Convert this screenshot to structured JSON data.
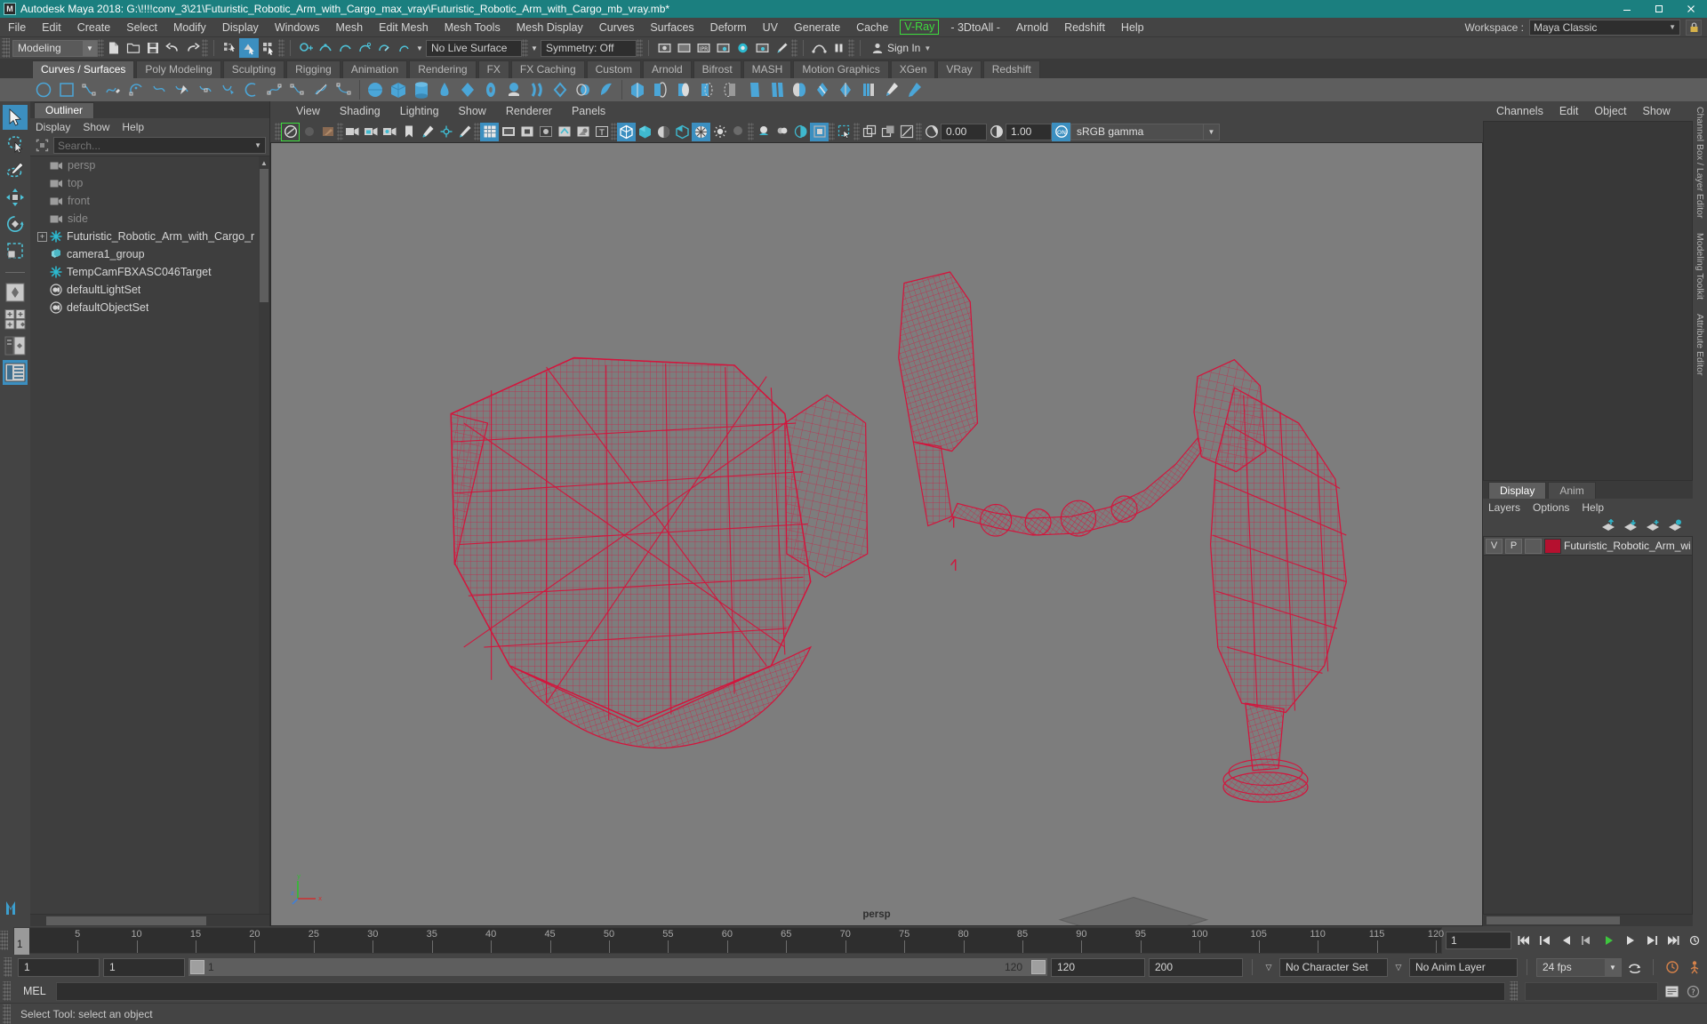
{
  "window": {
    "title": "Autodesk Maya 2018: G:\\!!!!conv_3\\21\\Futuristic_Robotic_Arm_with_Cargo_max_vray\\Futuristic_Robotic_Arm_with_Cargo_mb_vray.mb*",
    "logo_letter": "M",
    "minimize_label": "Minimize",
    "maximize_label": "Restore",
    "close_label": "Close"
  },
  "menubar": {
    "items": [
      {
        "label": "File"
      },
      {
        "label": "Edit"
      },
      {
        "label": "Create"
      },
      {
        "label": "Select"
      },
      {
        "label": "Modify"
      },
      {
        "label": "Display"
      },
      {
        "label": "Windows"
      },
      {
        "label": "Mesh"
      },
      {
        "label": "Edit Mesh"
      },
      {
        "label": "Mesh Tools"
      },
      {
        "label": "Mesh Display"
      },
      {
        "label": "Curves"
      },
      {
        "label": "Surfaces"
      },
      {
        "label": "Deform"
      },
      {
        "label": "UV"
      },
      {
        "label": "Generate"
      },
      {
        "label": "Cache"
      },
      {
        "label": "V-Ray",
        "highlight": true
      },
      {
        "label": "- 3DtoAll -"
      },
      {
        "label": "Arnold"
      },
      {
        "label": "Redshift"
      },
      {
        "label": "Help"
      }
    ],
    "workspace_label": "Workspace :",
    "workspace_value": "Maya Classic",
    "highlight_color": "#3ddc3d"
  },
  "statusbar": {
    "mode": "Modeling",
    "live_surface": "No Live Surface",
    "symmetry": "Symmetry: Off",
    "signin": "Sign In"
  },
  "shelf": {
    "tabs": [
      {
        "label": "Curves / Surfaces",
        "active": true
      },
      {
        "label": "Poly Modeling"
      },
      {
        "label": "Sculpting"
      },
      {
        "label": "Rigging"
      },
      {
        "label": "Animation"
      },
      {
        "label": "Rendering"
      },
      {
        "label": "FX"
      },
      {
        "label": "FX Caching"
      },
      {
        "label": "Custom"
      },
      {
        "label": "Arnold"
      },
      {
        "label": "Bifrost"
      },
      {
        "label": "MASH"
      },
      {
        "label": "Motion Graphics"
      },
      {
        "label": "XGen"
      },
      {
        "label": "VRay"
      },
      {
        "label": "Redshift"
      }
    ]
  },
  "outliner": {
    "tab_label": "Outliner",
    "menu": [
      "Display",
      "Show",
      "Help"
    ],
    "search_placeholder": "Search...",
    "search_value": "",
    "items": [
      {
        "label": "persp",
        "icon": "camera-icon",
        "dim": true,
        "indent": 1
      },
      {
        "label": "top",
        "icon": "camera-icon",
        "dim": true,
        "indent": 1
      },
      {
        "label": "front",
        "icon": "camera-icon",
        "dim": true,
        "indent": 1
      },
      {
        "label": "side",
        "icon": "camera-icon",
        "dim": true,
        "indent": 1
      },
      {
        "label": "Futuristic_Robotic_Arm_with_Cargo_r",
        "icon": "transform-icon",
        "dim": false,
        "indent": 1,
        "expandable": true
      },
      {
        "label": "camera1_group",
        "icon": "group-icon",
        "dim": false,
        "indent": 1
      },
      {
        "label": "TempCamFBXASC046Target",
        "icon": "transform-icon",
        "dim": false,
        "indent": 1
      },
      {
        "label": "defaultLightSet",
        "icon": "set-icon",
        "dim": false,
        "indent": 1
      },
      {
        "label": "defaultObjectSet",
        "icon": "set-icon",
        "dim": false,
        "indent": 1
      }
    ]
  },
  "viewport": {
    "menu": [
      "View",
      "Shading",
      "Lighting",
      "Show",
      "Renderer",
      "Panels"
    ],
    "exposure_value": "0.00",
    "gamma_value": "1.00",
    "color_management": "sRGB gamma",
    "camera_label": "persp",
    "background_color": "#7d7d7d",
    "wireframe_color": "#d4143c",
    "axis_labels": {
      "x": "x",
      "y": "y",
      "z": "z"
    }
  },
  "channelbox": {
    "tabs": [
      "Channels",
      "Edit",
      "Object",
      "Show"
    ],
    "side_labels": [
      "Channel Box / Layer Editor",
      "Modeling Toolkit",
      "Attribute Editor"
    ]
  },
  "layereditor": {
    "tabs": [
      {
        "label": "Display",
        "active": true
      },
      {
        "label": "Anim"
      }
    ],
    "menu": [
      "Layers",
      "Options",
      "Help"
    ],
    "columns": [
      "V",
      "P"
    ],
    "layers": [
      {
        "v": "V",
        "p": "P",
        "color": "#b5102f",
        "name": "Futuristic_Robotic_Arm_with_C"
      }
    ]
  },
  "timeslider": {
    "current_frame": "1",
    "ticks": [
      5,
      10,
      15,
      20,
      25,
      30,
      35,
      40,
      45,
      50,
      55,
      60,
      65,
      70,
      75,
      80,
      85,
      90,
      95,
      100,
      105,
      110,
      115,
      120
    ],
    "range_start": 1,
    "range_end": 120,
    "end_field": "1"
  },
  "rangeslider": {
    "anim_start": "1",
    "range_start": "1",
    "range_track_start_label": "1",
    "range_track_end_label": "120",
    "range_end": "120",
    "anim_end": "200",
    "character_set": "No Character Set",
    "anim_layer": "No Anim Layer",
    "fps": "24 fps"
  },
  "commandline": {
    "language": "MEL",
    "input_value": "",
    "output_value": ""
  },
  "helpline": {
    "text": "Select Tool: select an object"
  },
  "toolbox": {
    "tools": [
      {
        "name": "select-tool",
        "active": true
      },
      {
        "name": "lasso-select-tool",
        "active": false
      },
      {
        "name": "paint-select-tool",
        "active": false
      },
      {
        "name": "move-tool",
        "active": false
      },
      {
        "name": "rotate-tool",
        "active": false
      },
      {
        "name": "scale-tool",
        "active": false
      }
    ],
    "layouts": [
      {
        "name": "single-perspective-layout",
        "active": false
      },
      {
        "name": "four-view-layout",
        "active": false
      },
      {
        "name": "persp-outliner-layout",
        "active": false
      },
      {
        "name": "persp-graph-layout",
        "active": true
      }
    ]
  }
}
